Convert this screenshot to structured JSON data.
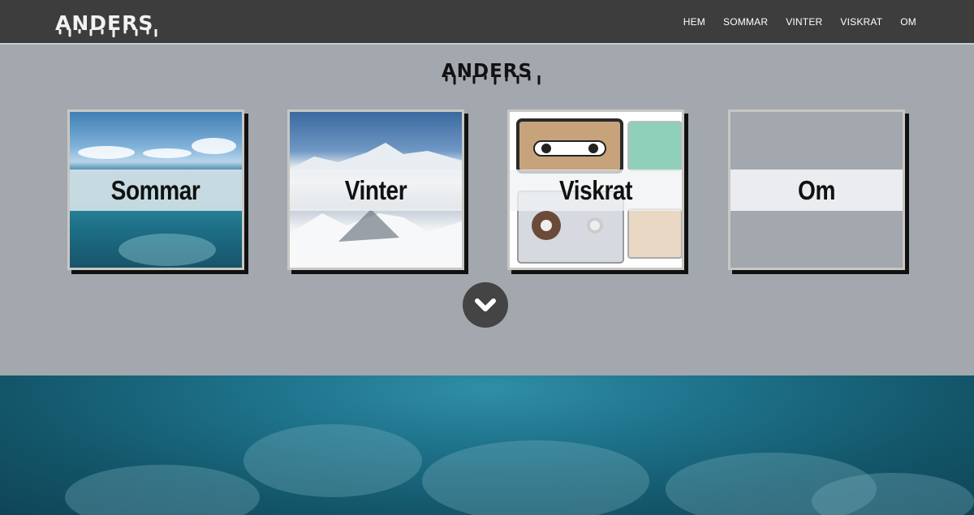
{
  "header": {
    "logo_text": "ANDERS",
    "nav": [
      "HEM",
      "SOMMAR",
      "VINTER",
      "VISKRAT",
      "OM"
    ]
  },
  "hero": {
    "title": "ANDERS"
  },
  "cards": [
    {
      "label": "Sommar",
      "image": "ocean-surface-and-reef"
    },
    {
      "label": "Vinter",
      "image": "snowy-mountains"
    },
    {
      "label": "Viskrat",
      "image": "cassette-tapes"
    },
    {
      "label": "Om",
      "image": "none"
    }
  ],
  "scroll_button": {
    "icon": "chevron-down-icon"
  },
  "colors": {
    "nav_bg": "#3d3d3d",
    "page_bg": "#a2a8ae",
    "button_bg": "#444444",
    "underwater": "#1d7189"
  }
}
